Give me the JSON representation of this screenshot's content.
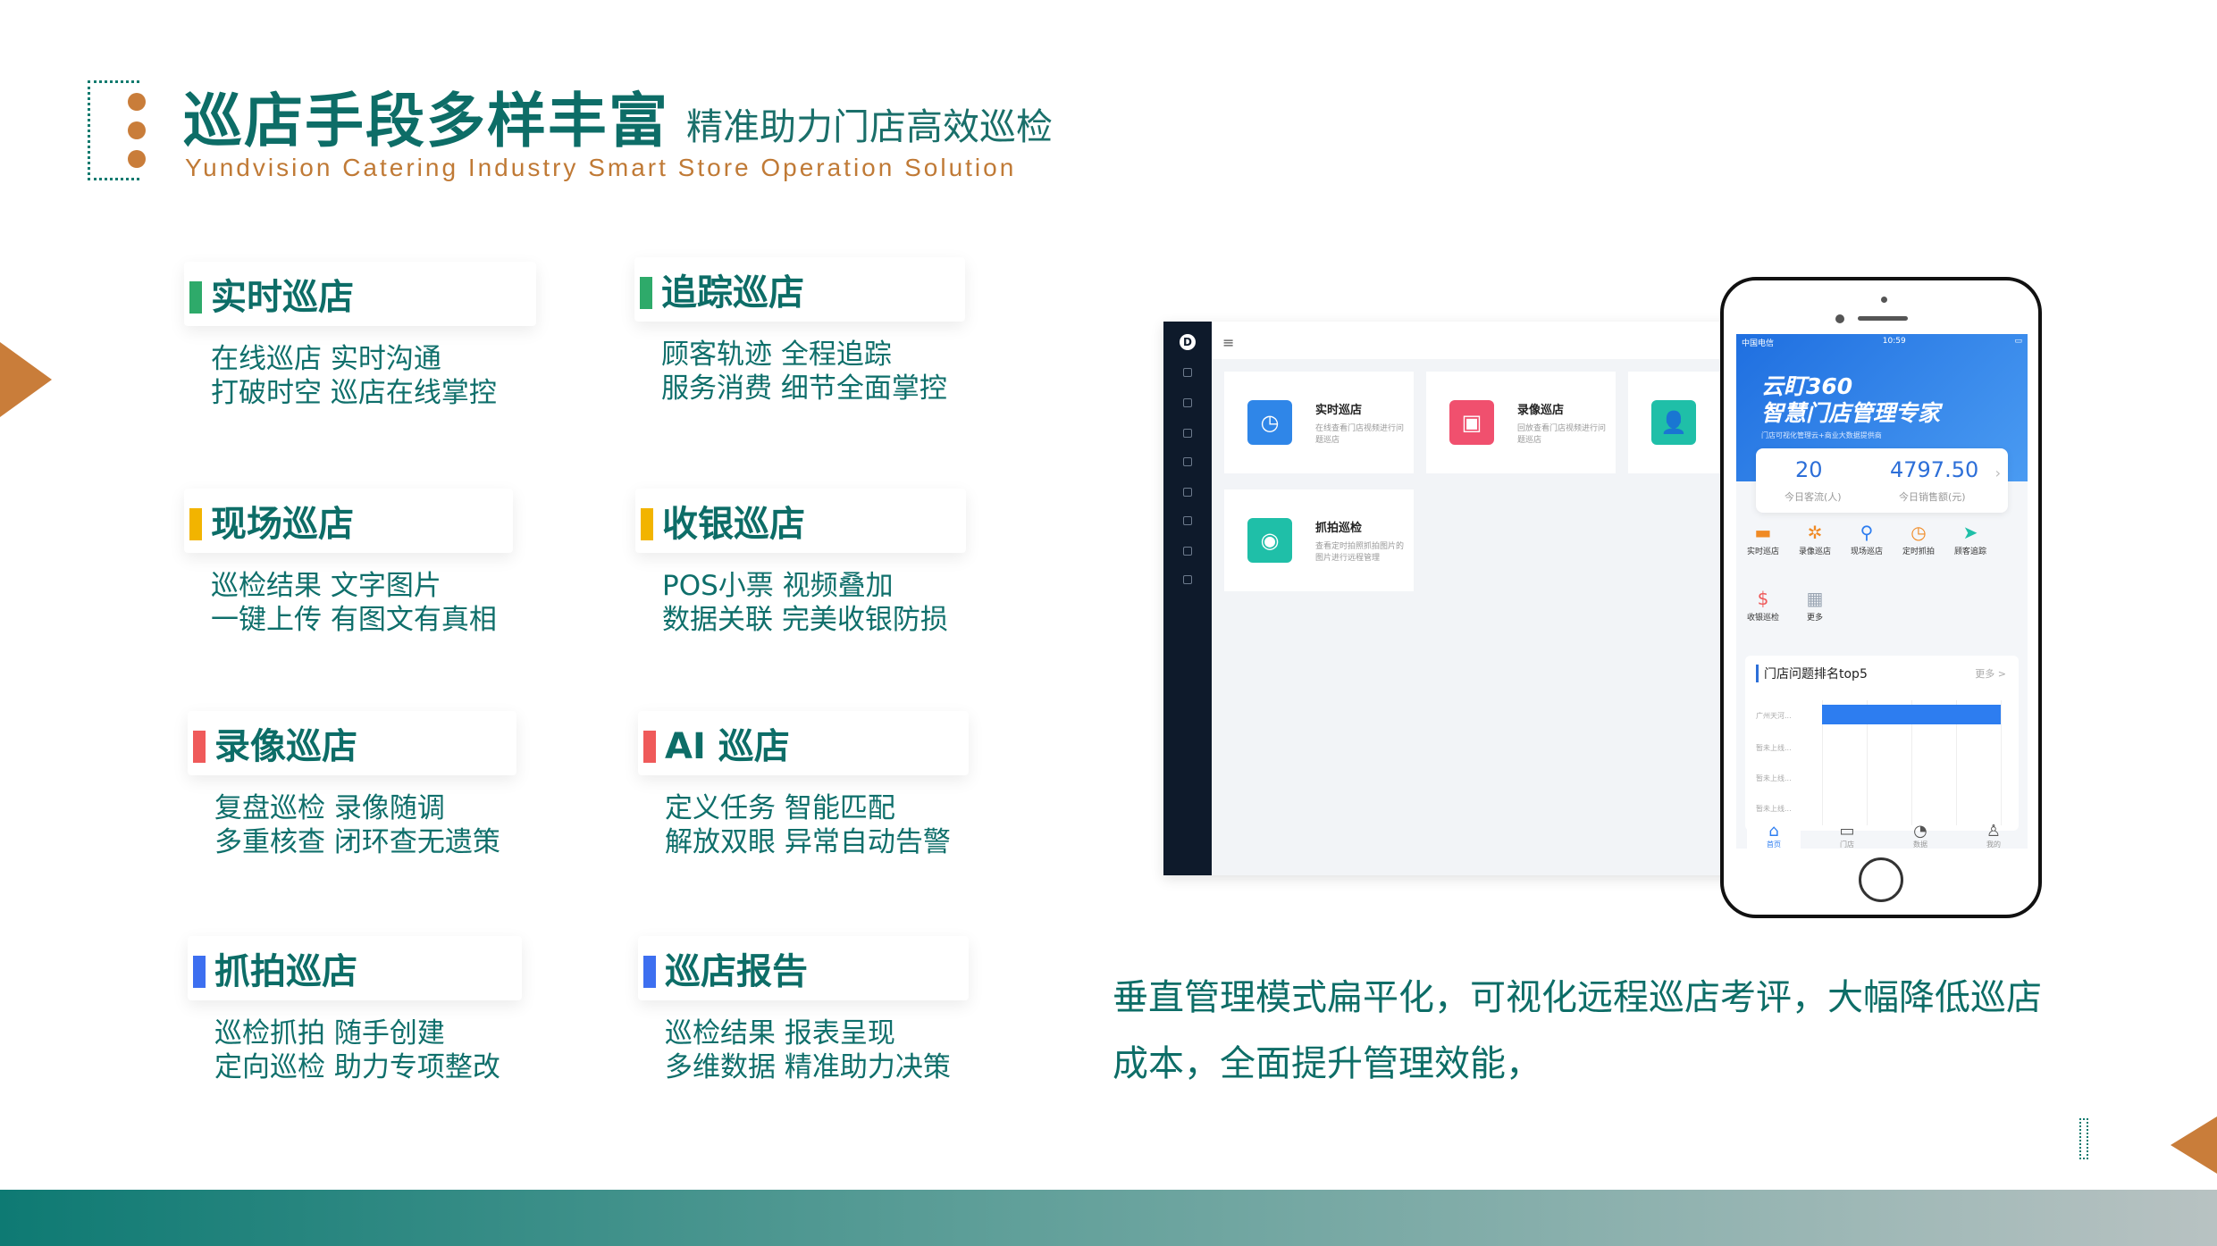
{
  "header": {
    "title": "巡店手段多样丰富",
    "subtitle": "精准助力门店高效巡检",
    "english": "Yundvision Catering Industry Smart Store Operation Solution"
  },
  "features": [
    {
      "title": "实时巡店",
      "color": "#2eaa6a",
      "line1": "在线巡店  实时沟通",
      "line2": "打破时空  巡店在线掌控"
    },
    {
      "title": "追踪巡店",
      "color": "#2eaa6a",
      "line1": "顾客轨迹  全程追踪",
      "line2": "服务消费  细节全面掌控"
    },
    {
      "title": "现场巡店",
      "color": "#f2b400",
      "line1": "巡检结果  文字图片",
      "line2": "一键上传  有图文有真相"
    },
    {
      "title": "收银巡店",
      "color": "#f2b400",
      "line1": "POS小票  视频叠加",
      "line2": "数据关联  完美收银防损"
    },
    {
      "title": "录像巡店",
      "color": "#ef5a5a",
      "line1": "复盘巡检  录像随调",
      "line2": "多重核查  闭环查无遗策"
    },
    {
      "title": "AI 巡店",
      "color": "#ef5a5a",
      "line1": "定义任务  智能匹配",
      "line2": "解放双眼  异常自动告警"
    },
    {
      "title": "抓拍巡店",
      "color": "#3d6ff0",
      "line1": "巡检抓拍  随手创建",
      "line2": "定向巡检  助力专项整改"
    },
    {
      "title": "巡店报告",
      "color": "#3d6ff0",
      "line1": "巡检结果  报表呈现",
      "line2": "多维数据  精准助力决策"
    }
  ],
  "desktop": {
    "menu_icon": "≡",
    "logo": "D",
    "cards": [
      {
        "title": "实时巡店",
        "desc": "在线查看门店视频进行问题巡店",
        "color": "#2f86e8",
        "icon": "clock-icon",
        "glyph": "◷"
      },
      {
        "title": "录像巡店",
        "desc": "回放查看门店视频进行问题巡店",
        "color": "#f0506e",
        "icon": "video-icon",
        "glyph": "▣"
      },
      {
        "title": "",
        "desc": "",
        "color": "#1fbfa8",
        "icon": "user-icon",
        "glyph": "👤"
      },
      {
        "title": "抓拍巡检",
        "desc": "查看定时拍照抓拍图片的图片进行远程管理",
        "color": "#1fbfa8",
        "icon": "camera-icon",
        "glyph": "◉"
      }
    ]
  },
  "phone": {
    "status_left": "中国电信",
    "status_time": "10:59",
    "app_name_1": "云盯360",
    "app_name_2": "智慧门店管理专家",
    "app_sub": "门店可视化管理云+商业大数据提供商",
    "stat1_value": "20",
    "stat1_label": "今日客流(人)",
    "stat2_value": "4797.50",
    "stat2_label": "今日销售额(元)",
    "icons": [
      {
        "label": "实时巡店",
        "glyph": "▬",
        "color": "#f08a24"
      },
      {
        "label": "录像巡店",
        "glyph": "✲",
        "color": "#f08a24"
      },
      {
        "label": "现场巡店",
        "glyph": "⚲",
        "color": "#2d7df0"
      },
      {
        "label": "定时抓拍",
        "glyph": "◷",
        "color": "#f08a24"
      },
      {
        "label": "顾客追踪",
        "glyph": "➤",
        "color": "#1fbfa8"
      },
      {
        "label": "收银巡检",
        "glyph": "$",
        "color": "#ef5a5a"
      },
      {
        "label": "更多",
        "glyph": "▦",
        "color": "#9aa5b3"
      }
    ],
    "rank_title": "门店问题排名top5",
    "rank_more": "更多 >",
    "rank_rows": [
      "广州天河...",
      "暂未上线...",
      "暂未上线...",
      "暂未上线..."
    ],
    "tabs": [
      {
        "label": "首页",
        "glyph": "⌂"
      },
      {
        "label": "门店",
        "glyph": "▭"
      },
      {
        "label": "数据",
        "glyph": "◔"
      },
      {
        "label": "我的",
        "glyph": "♙"
      }
    ]
  },
  "summary_line1": "垂直管理模式扁平化，可视化远程巡店考评，大幅降低巡店",
  "summary_line2": "成本，全面提升管理效能，"
}
